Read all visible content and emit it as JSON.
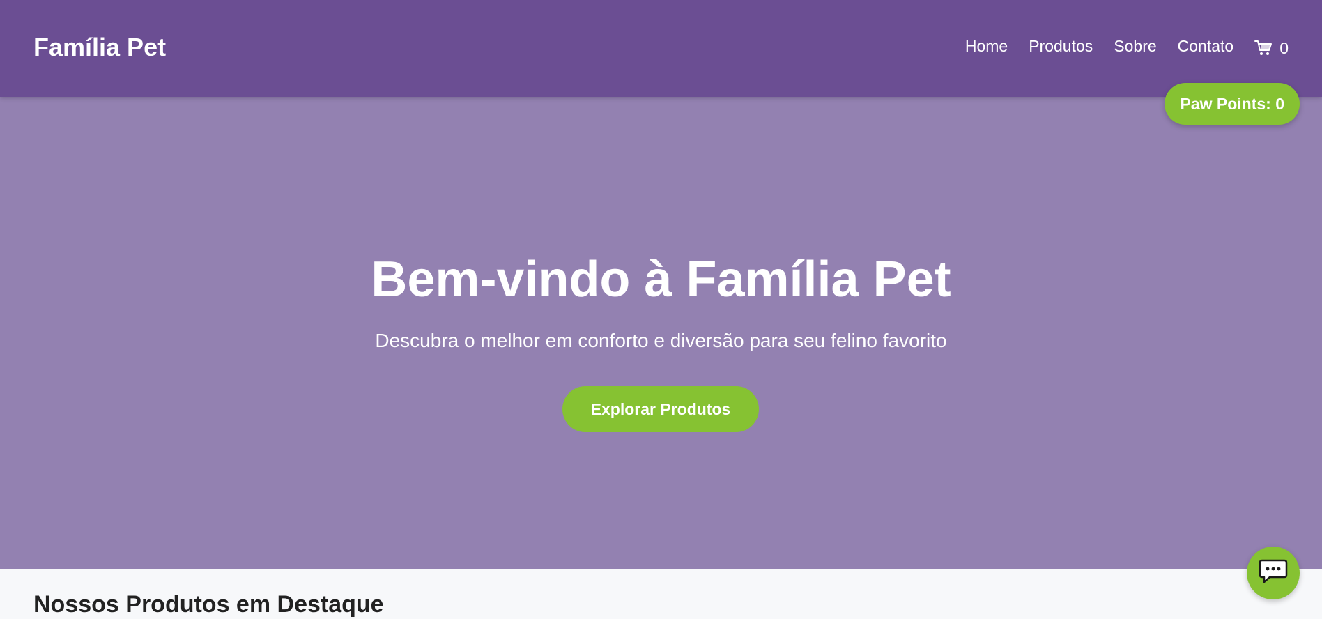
{
  "colors": {
    "header_bg": "#6b4e93",
    "hero_bg": "#9381b1",
    "accent_green": "#86c232",
    "text_white": "#ffffff",
    "section_bg": "#f7f8fa"
  },
  "header": {
    "brand": "Família Pet",
    "nav": [
      {
        "label": "Home"
      },
      {
        "label": "Produtos"
      },
      {
        "label": "Sobre"
      },
      {
        "label": "Contato"
      }
    ],
    "cart": {
      "icon": "shopping-cart-icon",
      "count": "0"
    }
  },
  "paw_points": {
    "label": "Paw Points: 0"
  },
  "hero": {
    "title": "Bem-vindo à Família Pet",
    "subtitle": "Descubra o melhor em conforto e diversão para seu felino favorito",
    "cta_label": "Explorar Produtos"
  },
  "featured": {
    "title": "Nossos Produtos em Destaque"
  },
  "chat": {
    "icon": "chat-bubble-icon"
  }
}
